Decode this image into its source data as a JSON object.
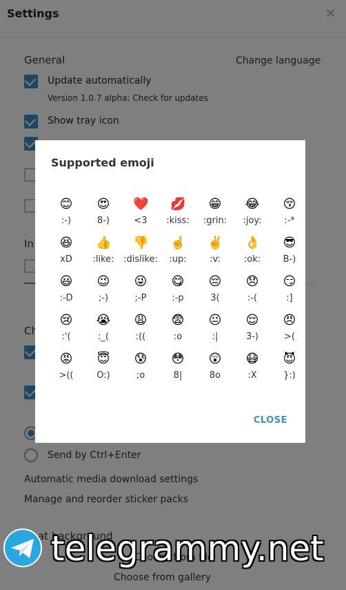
{
  "window": {
    "title": "Settings",
    "close_glyph": "✕"
  },
  "general": {
    "heading": "General",
    "change_language": "Change language",
    "update_automatically": "Update automatically",
    "version_text": "Version 1.0.7 alpha: Check for updates",
    "show_tray_icon": "Show tray icon",
    "partial_labels": [
      "In",
      "Ch"
    ]
  },
  "chat": {
    "send_by_ctrl_enter": "Send by Ctrl+Enter",
    "auto_media": "Automatic media download settings",
    "manage_stickers": "Manage and reorder sticker packs",
    "chat_background": "Chat background",
    "choose_from_file": "Choose from file",
    "choose_gallery": "Choose from gallery"
  },
  "dialog": {
    "title": "Supported emoji",
    "close_label": "CLOSE",
    "emoji": [
      {
        "glyph": "😊",
        "code": ":-)"
      },
      {
        "glyph": "😍",
        "code": "8-)"
      },
      {
        "glyph": "❤️",
        "code": "<3"
      },
      {
        "glyph": "💋",
        "code": ":kiss:"
      },
      {
        "glyph": "😁",
        "code": ":grin:"
      },
      {
        "glyph": "😂",
        "code": ":joy:"
      },
      {
        "glyph": "😚",
        "code": ":-*"
      },
      {
        "glyph": "😆",
        "code": "xD"
      },
      {
        "glyph": "👍",
        "code": ":like:"
      },
      {
        "glyph": "👎",
        "code": ":dislike:"
      },
      {
        "glyph": "☝️",
        "code": ":up:"
      },
      {
        "glyph": "✌️",
        "code": ":v:"
      },
      {
        "glyph": "👌",
        "code": ":ok:"
      },
      {
        "glyph": "😎",
        "code": "B-)"
      },
      {
        "glyph": "😃",
        "code": ":-D"
      },
      {
        "glyph": "😉",
        "code": ";-)"
      },
      {
        "glyph": "😜",
        "code": ";-P"
      },
      {
        "glyph": "😋",
        "code": ":-p"
      },
      {
        "glyph": "😔",
        "code": "3("
      },
      {
        "glyph": "😞",
        "code": ":-("
      },
      {
        "glyph": "😏",
        "code": ":]"
      },
      {
        "glyph": "😢",
        "code": ":'("
      },
      {
        "glyph": "😭",
        "code": ":_("
      },
      {
        "glyph": "😩",
        "code": ":(("
      },
      {
        "glyph": "😨",
        "code": ":o"
      },
      {
        "glyph": "😐",
        "code": ":|"
      },
      {
        "glyph": "😌",
        "code": "3-)"
      },
      {
        "glyph": "😠",
        "code": ">("
      },
      {
        "glyph": "😡",
        "code": ">(("
      },
      {
        "glyph": "😇",
        "code": "O:)"
      },
      {
        "glyph": "😰",
        "code": ";o"
      },
      {
        "glyph": "😳",
        "code": "8|"
      },
      {
        "glyph": "😲",
        "code": "8o"
      },
      {
        "glyph": "😷",
        "code": ":X"
      },
      {
        "glyph": "😈",
        "code": "}:)"
      }
    ]
  },
  "watermark": {
    "text": "telegrammy.net"
  },
  "colors": {
    "accent": "#3d8fc9",
    "overlay": "rgba(0,0,0,0.5)"
  }
}
